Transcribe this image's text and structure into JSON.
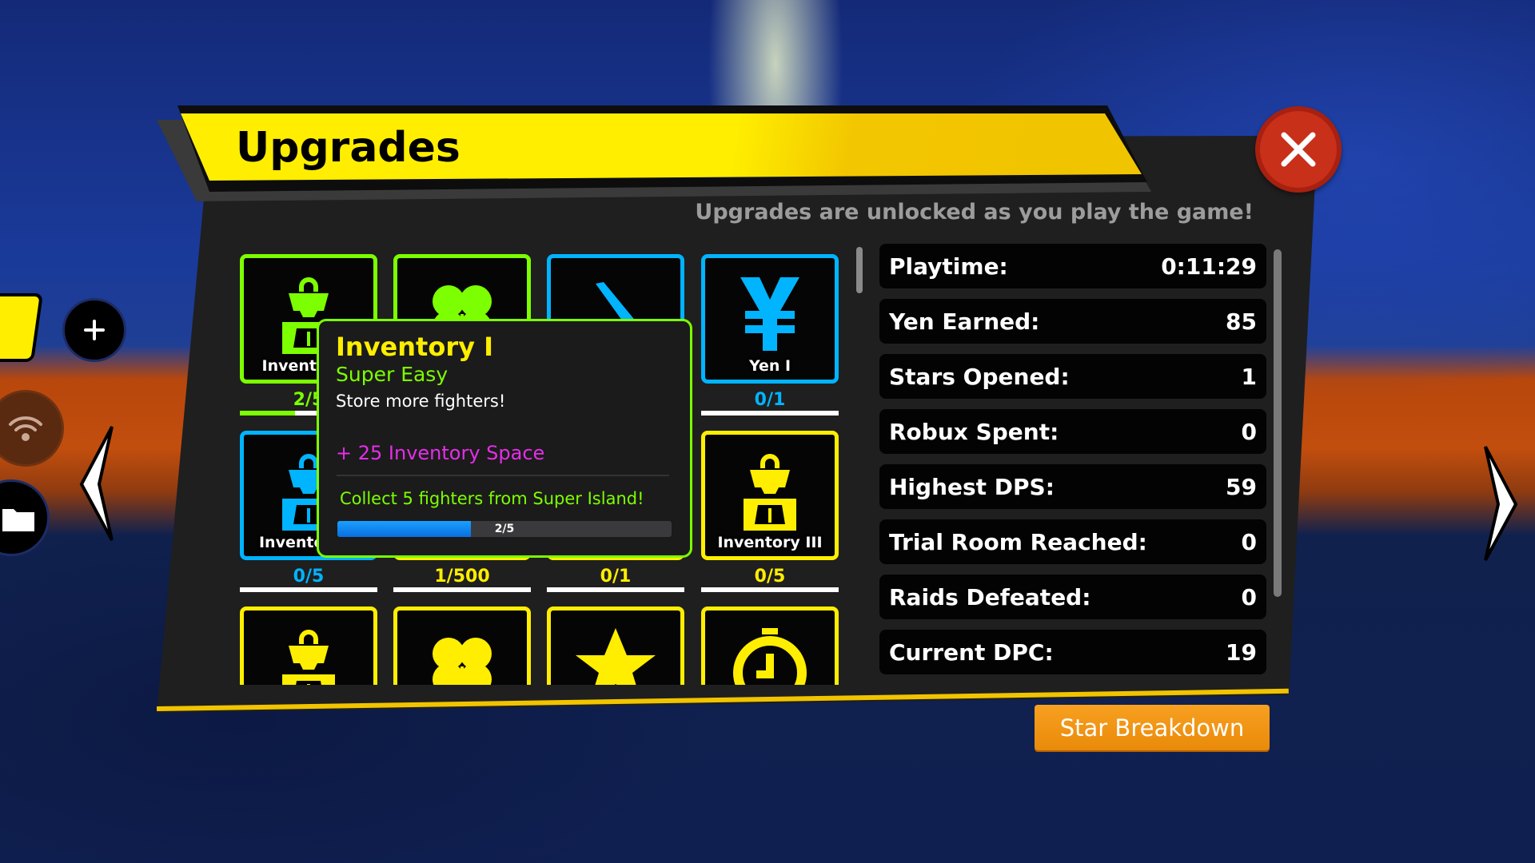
{
  "window": {
    "title": "Upgrades",
    "subtitle": "Upgrades are unlocked as you play the game!",
    "close_icon": "x-icon"
  },
  "colors": {
    "green": "#7cff00",
    "blue": "#00b4ff",
    "yellow": "#ffee00",
    "close": "#c8301a",
    "button": "#f09418",
    "magenta": "#e42ee8"
  },
  "tiles": [
    {
      "icon": "backpack",
      "color": "green",
      "label": "Inventory I",
      "count": "2/5",
      "progress": 0.4
    },
    {
      "icon": "clover",
      "color": "green",
      "label": "",
      "count": "",
      "progress": 0
    },
    {
      "icon": "sword",
      "color": "blue",
      "label": "",
      "count": "",
      "progress": 0
    },
    {
      "icon": "yen",
      "color": "blue",
      "label": "Yen I",
      "count": "0/1",
      "progress": 0
    },
    {
      "icon": "backpack",
      "color": "blue",
      "label": "Inventory II",
      "count": "0/5",
      "progress": 0
    },
    {
      "icon": "clover",
      "color": "yellow",
      "label": "",
      "count": "1/500",
      "progress": 0
    },
    {
      "icon": "sword",
      "color": "yellow",
      "label": "",
      "count": "0/1",
      "progress": 0
    },
    {
      "icon": "backpack",
      "color": "yellow",
      "label": "Inventory III",
      "count": "0/5",
      "progress": 0
    },
    {
      "icon": "backpack",
      "color": "yellow",
      "label": "",
      "count": "",
      "progress": 0
    },
    {
      "icon": "clover",
      "color": "yellow",
      "label": "",
      "count": "",
      "progress": 0
    },
    {
      "icon": "star",
      "color": "yellow",
      "label": "",
      "count": "",
      "progress": 0
    },
    {
      "icon": "stopwatch",
      "color": "yellow",
      "label": "",
      "count": "",
      "progress": 0
    }
  ],
  "tooltip": {
    "title": "Inventory I",
    "difficulty": "Super Easy",
    "description": "Store more fighters!",
    "bonus": "+ 25 Inventory Space",
    "requirement": "Collect 5 fighters from Super Island!",
    "progress_text": "2/5",
    "progress": 0.4
  },
  "stats": [
    {
      "label": "Playtime:",
      "value": "0:11:29"
    },
    {
      "label": "Yen Earned:",
      "value": "85"
    },
    {
      "label": "Stars Opened:",
      "value": "1"
    },
    {
      "label": "Robux Spent:",
      "value": "0"
    },
    {
      "label": "Highest DPS:",
      "value": "59"
    },
    {
      "label": "Trial Room Reached:",
      "value": "0"
    },
    {
      "label": "Raids Defeated:",
      "value": "0"
    },
    {
      "label": "Current DPC:",
      "value": "19"
    }
  ],
  "star_breakdown_label": "Star Breakdown",
  "side": {
    "plus_icon": "plus-icon",
    "wifi_icon": "wifi-icon",
    "folder_icon": "folder-icon",
    "prev_icon": "chevron-left-icon",
    "next_icon": "chevron-right-icon"
  }
}
